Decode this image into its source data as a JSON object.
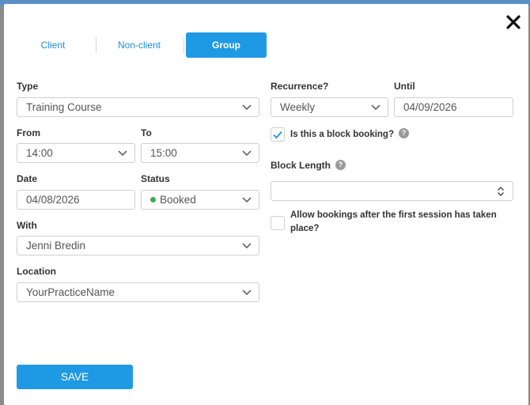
{
  "tabs": [
    {
      "label": "Client",
      "active": false
    },
    {
      "label": "Non-client",
      "active": false
    },
    {
      "label": "Group",
      "active": true
    }
  ],
  "form": {
    "type": {
      "label": "Type",
      "value": "Training Course"
    },
    "from": {
      "label": "From",
      "value": "14:00"
    },
    "to": {
      "label": "To",
      "value": "15:00"
    },
    "date": {
      "label": "Date",
      "value": "04/08/2026"
    },
    "status": {
      "label": "Status",
      "value": "Booked",
      "color": "#3cae4a"
    },
    "with": {
      "label": "With",
      "value": "Jenni Bredin"
    },
    "location": {
      "label": "Location",
      "value": "YourPracticeName"
    },
    "recurrence": {
      "label": "Recurrence?",
      "value": "Weekly"
    },
    "until": {
      "label": "Until",
      "value": "04/09/2026"
    },
    "block_booking": {
      "label": "Is this a block booking?",
      "checked": true,
      "help": "?"
    },
    "block_length": {
      "label": "Block Length",
      "value": "",
      "help": "?"
    },
    "allow_after": {
      "line1": "Allow bookings after the first session has taken",
      "line2": "place?",
      "checked": false
    }
  },
  "save_label": "SAVE",
  "colors": {
    "accent": "#1e9ae4",
    "status_booked": "#3cae4a"
  }
}
